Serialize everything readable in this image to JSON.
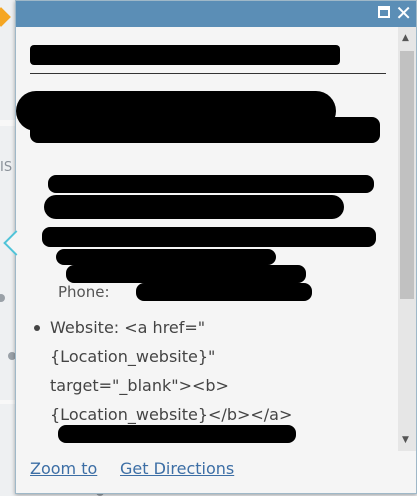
{
  "popup": {
    "phone_fragment": "Phone:",
    "website_label": "Website: <a href=\" {Location_website}\" target=\"_blank\"><b> {Location_website}</b></a>"
  },
  "footer": {
    "zoom_label": "Zoom to",
    "directions_label": "Get Directions"
  },
  "icons": [
    "maximize-icon",
    "close-icon",
    "scroll-up-icon",
    "scroll-down-icon"
  ],
  "colors": {
    "titlebar": "#5b8eb6",
    "link": "#3c6ea5",
    "background": "#f5f5f5"
  }
}
